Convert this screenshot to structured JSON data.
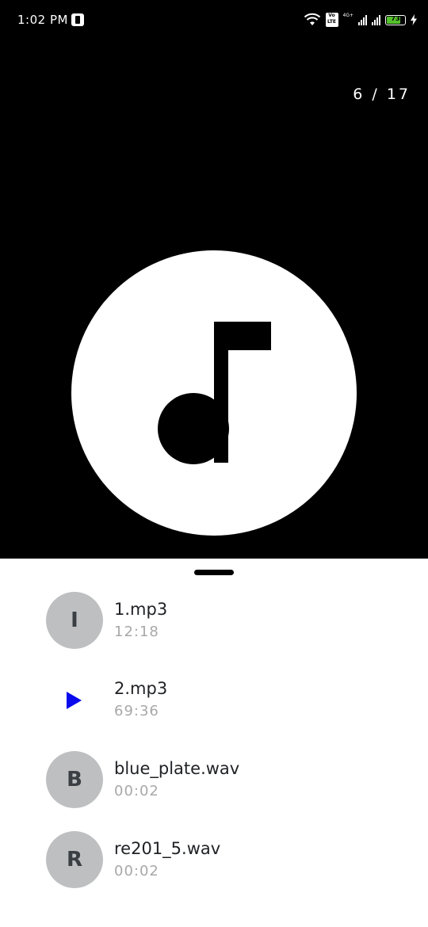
{
  "status_bar": {
    "time": "1:02 PM",
    "volte": "Vo LTE",
    "network": "4G+",
    "battery_level": "73"
  },
  "player": {
    "counter": "6 / 17"
  },
  "playlist": {
    "tracks": [
      {
        "avatar": "I",
        "title": "1.mp3",
        "duration": "12:18",
        "playing": false
      },
      {
        "avatar": "",
        "title": "2.mp3",
        "duration": "69:36",
        "playing": true
      },
      {
        "avatar": "B",
        "title": "blue_plate.wav",
        "duration": "00:02",
        "playing": false
      },
      {
        "avatar": "R",
        "title": "re201_5.wav",
        "duration": "00:02",
        "playing": false
      }
    ]
  },
  "colors": {
    "background": "#000000",
    "sheet": "#ffffff",
    "avatar_bg": "#bdbfc1",
    "playing_indicator": "#0a0aee",
    "battery_fill": "#55c12c"
  }
}
